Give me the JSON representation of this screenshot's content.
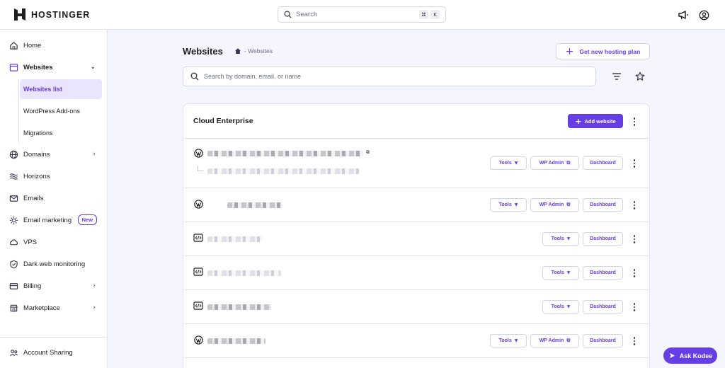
{
  "brand": {
    "name": "HOSTINGER"
  },
  "topbar": {
    "search_placeholder": "Search",
    "shortcut_keys": [
      "⌘",
      "K"
    ],
    "icons": [
      "megaphone-icon",
      "account-icon"
    ]
  },
  "sidebar": {
    "items": [
      {
        "label": "Home",
        "icon": "home-icon"
      },
      {
        "label": "Websites",
        "icon": "websites-icon"
      },
      {
        "label": "Domains",
        "icon": "globe-icon"
      },
      {
        "label": "Horizons",
        "icon": "horizons-icon"
      },
      {
        "label": "Emails",
        "icon": "mail-icon"
      },
      {
        "label": "Email marketing",
        "icon": "email-marketing-icon",
        "badge": "New"
      },
      {
        "label": "VPS",
        "icon": "cloud-icon"
      },
      {
        "label": "Dark web monitoring",
        "icon": "shield-icon"
      },
      {
        "label": "Billing",
        "icon": "billing-icon"
      },
      {
        "label": "Marketplace",
        "icon": "marketplace-icon"
      }
    ],
    "sub_items": [
      {
        "label": "Websites list",
        "active": true
      },
      {
        "label": "WordPress Add-ons"
      },
      {
        "label": "Migrations"
      }
    ],
    "footer_item": {
      "label": "Account Sharing",
      "icon": "users-icon"
    }
  },
  "main": {
    "title": "Websites",
    "breadcrumb": "- Websites",
    "new_plan_button": "Get new hosting plan",
    "search_placeholder": "Search by domain, email, or name",
    "card": {
      "title": "Cloud Enterprise",
      "add_button": "Add website",
      "rows": [
        {
          "type": "wordpress",
          "actions": [
            "Tools",
            "WP Admin",
            "Dashboard"
          ]
        },
        {
          "type": "wordpress",
          "actions": [
            "Tools",
            "WP Admin",
            "Dashboard"
          ]
        },
        {
          "type": "code",
          "actions": [
            "Tools",
            "Dashboard"
          ]
        },
        {
          "type": "code",
          "actions": [
            "Tools",
            "Dashboard"
          ]
        },
        {
          "type": "code",
          "actions": [
            "Tools",
            "Dashboard"
          ]
        },
        {
          "type": "wordpress",
          "actions": [
            "Tools",
            "WP Admin",
            "Dashboard"
          ]
        }
      ]
    }
  },
  "assistant": {
    "label": "Ask Kodee"
  },
  "colors": {
    "accent": "#673de6",
    "accent_light": "#ebe4ff",
    "background": "#f4f5ff"
  }
}
